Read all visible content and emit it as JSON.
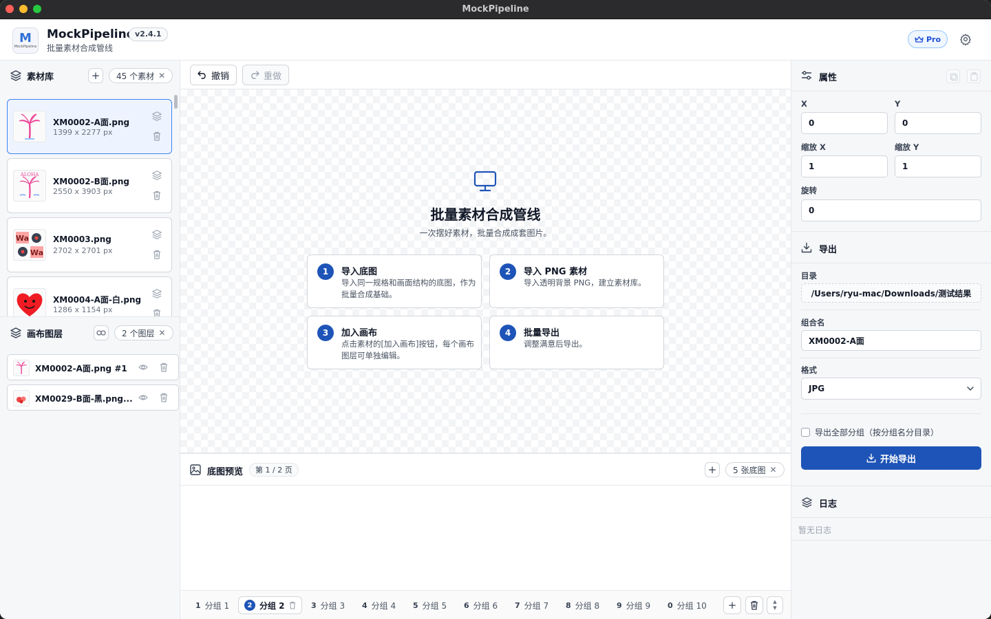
{
  "window": {
    "title": "MockPipeline"
  },
  "app": {
    "logo_mark": "M",
    "logo_text": "MockPipeline",
    "name": "MockPipeline",
    "version": "v2.4.1",
    "subtitle": "批量素材合成管线",
    "pro_label": "Pro"
  },
  "library": {
    "title": "素材库",
    "count_label": "45 个素材",
    "items": [
      {
        "name": "XM0002-A面.png",
        "size": "1399 x 2277 px",
        "thumb": "palm-tree"
      },
      {
        "name": "XM0002-B面.png",
        "size": "2550 x 3903 px",
        "thumb": "aloha-palm"
      },
      {
        "name": "XM0003.png",
        "size": "2702 x 2701 px",
        "thumb": "wa-flowers"
      },
      {
        "name": "XM0004-A面-白.png",
        "size": "1286 x 1154 px",
        "thumb": "red-heart"
      }
    ]
  },
  "layers": {
    "title": "画布图层",
    "count_label": "2 个图层",
    "items": [
      {
        "name": "XM0002-A面.png #1"
      },
      {
        "name": "XM0029-B面-黑.png..."
      }
    ]
  },
  "toolbar": {
    "undo": "撤销",
    "redo": "重做"
  },
  "canvas": {
    "title": "批量素材合成管线",
    "subtitle": "一次摆好素材，批量合成成套图片。",
    "steps": [
      {
        "num": "1",
        "title": "导入底图",
        "desc": "导入同一规格和画面结构的底图，作为批量合成基础。"
      },
      {
        "num": "2",
        "title": "导入 PNG 素材",
        "desc": "导入透明背景 PNG，建立素材库。"
      },
      {
        "num": "3",
        "title": "加入画布",
        "desc": "点击素材的[加入画布]按钮，每个画布图层可单独编辑。"
      },
      {
        "num": "4",
        "title": "批量导出",
        "desc": "调整满意后导出。"
      }
    ]
  },
  "preview": {
    "title": "底图预览",
    "page_label": "第 1 / 2 页",
    "count_label": "5 张底图"
  },
  "groups": {
    "tabs": [
      {
        "num": "1",
        "label": "分组 1"
      },
      {
        "num": "2",
        "label": "分组 2"
      },
      {
        "num": "3",
        "label": "分组 3"
      },
      {
        "num": "4",
        "label": "分组 4"
      },
      {
        "num": "5",
        "label": "分组 5"
      },
      {
        "num": "6",
        "label": "分组 6"
      },
      {
        "num": "7",
        "label": "分组 7"
      },
      {
        "num": "8",
        "label": "分组 8"
      },
      {
        "num": "9",
        "label": "分组 9"
      },
      {
        "num": "0",
        "label": "分组 10"
      }
    ],
    "active_index": 1
  },
  "properties": {
    "title": "属性",
    "x_label": "X",
    "x_value": "0",
    "y_label": "Y",
    "y_value": "0",
    "scale_x_label": "缩放 X",
    "scale_x_value": "1",
    "scale_y_label": "缩放 Y",
    "scale_y_value": "1",
    "rotate_label": "旋转",
    "rotate_value": "0"
  },
  "export": {
    "title": "导出",
    "dir_label": "目录",
    "dir_value": "/Users/ryu-mac/Downloads/测试结果",
    "group_name_label": "组合名",
    "group_name_value": "XM0002-A面",
    "format_label": "格式",
    "format_value": "JPG",
    "export_all_label": "导出全部分组（按分组名分目录）",
    "start_button": "开始导出"
  },
  "log": {
    "title": "日志",
    "empty": "暂无日志"
  },
  "colors": {
    "accent": "#1e54b7",
    "pro": "#1d4ed8",
    "border": "#d1d5db"
  }
}
